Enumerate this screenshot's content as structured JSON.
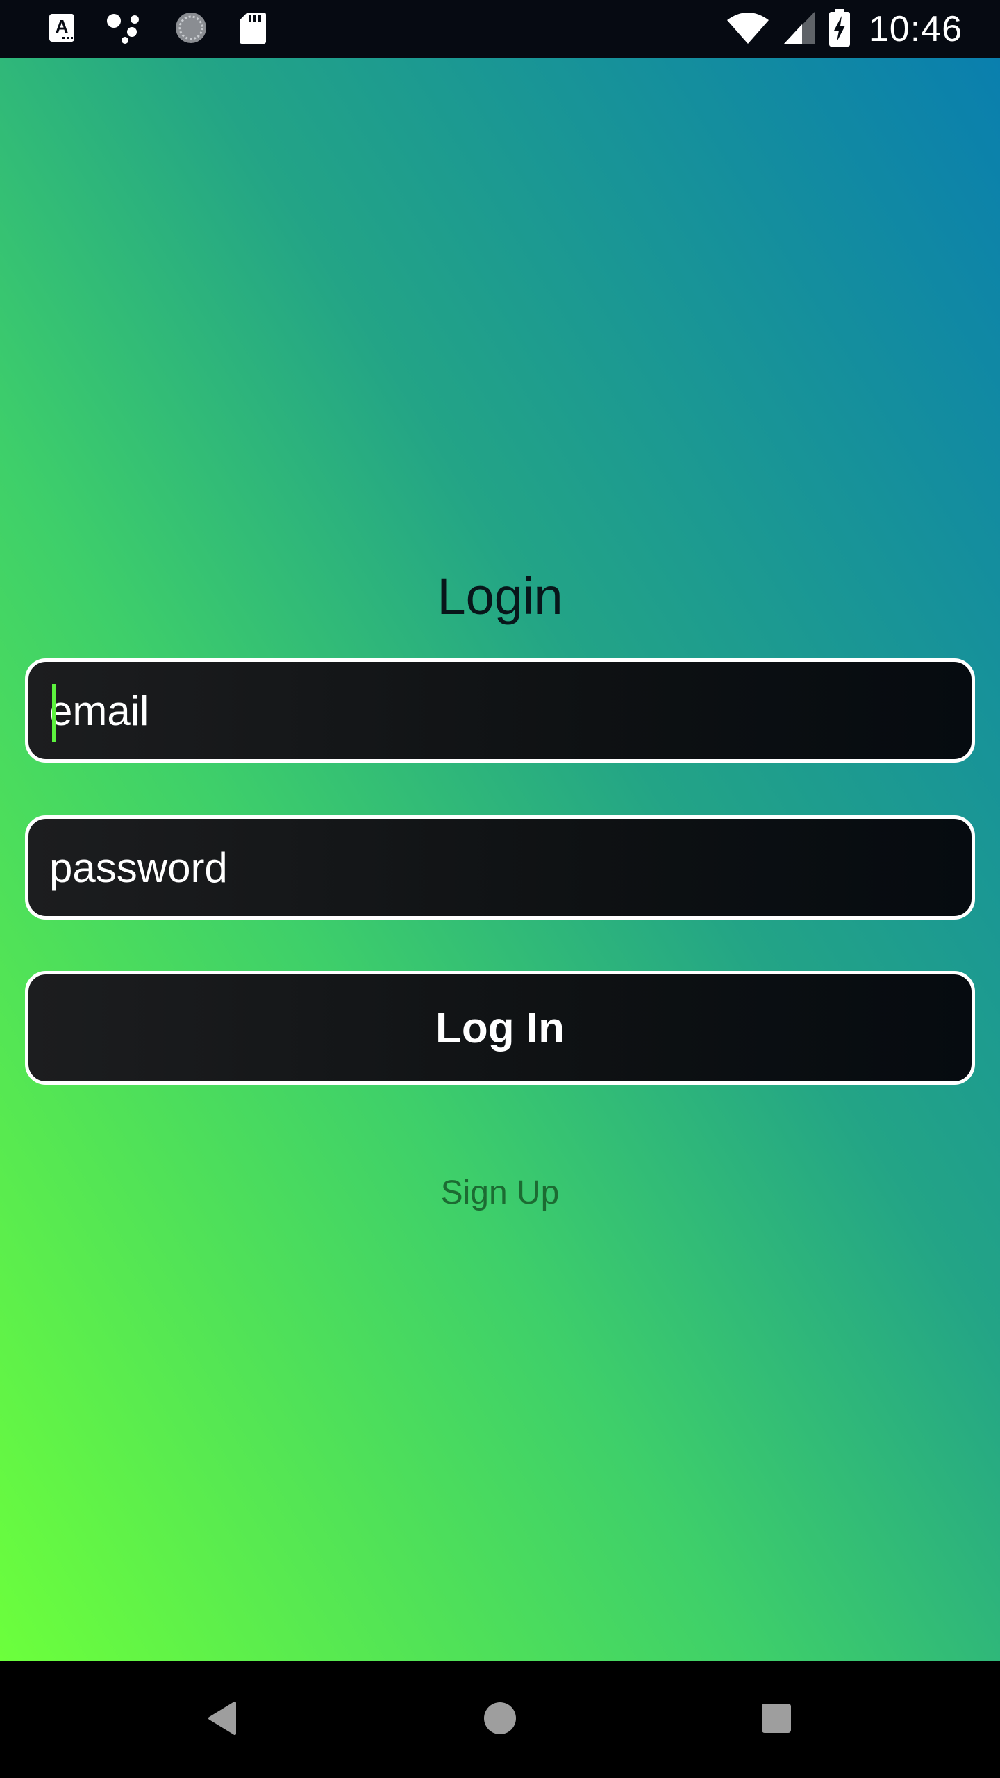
{
  "status_bar": {
    "time": "10:46",
    "icons": [
      "font-a-icon",
      "assistant-dots-icon",
      "sync-circle-icon",
      "sd-card-icon",
      "wifi-icon",
      "signal-icon",
      "battery-charging-icon"
    ]
  },
  "colors": {
    "gradient_bottom_left": "#6cff3c",
    "gradient_top_right": "#0a7fae",
    "field_background": "#0e1113",
    "field_border": "#ffffff",
    "caret": "#5cf23e",
    "signup_text": "#1c6b32"
  },
  "login": {
    "title": "Login",
    "email_placeholder": "email",
    "email_value": "",
    "password_placeholder": "password",
    "password_value": "",
    "login_button_label": "Log In",
    "signup_label": "Sign Up"
  },
  "nav_bar": {
    "buttons": [
      "back-icon",
      "home-icon",
      "recents-icon"
    ]
  }
}
